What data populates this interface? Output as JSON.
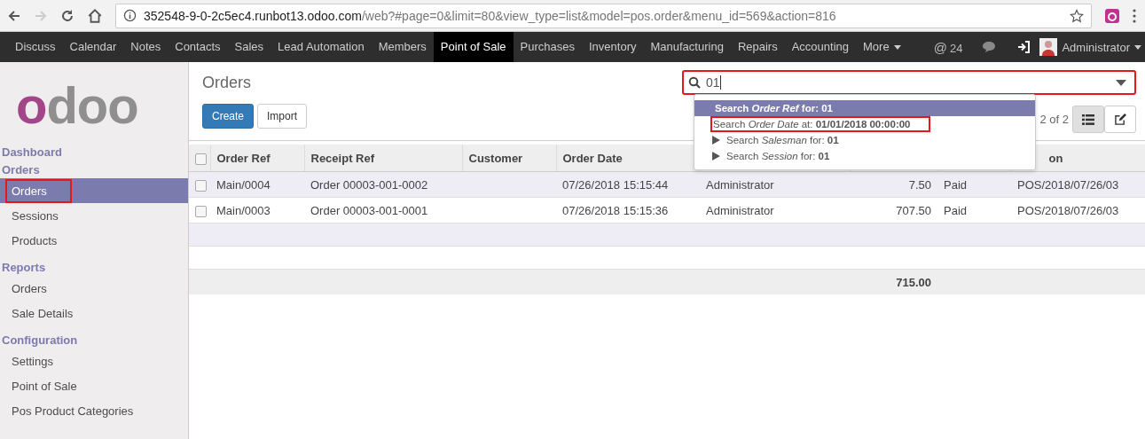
{
  "browser": {
    "url_host": "352548-9-0-2c5ec4.runbot13.odoo.com",
    "url_path": "/web?#page=0&limit=80&view_type=list&model=pos.order&menu_id=569&action=816"
  },
  "navbar": {
    "apps": [
      {
        "label": "Discuss",
        "selected": false
      },
      {
        "label": "Calendar",
        "selected": false
      },
      {
        "label": "Notes",
        "selected": false
      },
      {
        "label": "Contacts",
        "selected": false
      },
      {
        "label": "Sales",
        "selected": false
      },
      {
        "label": "Lead Automation",
        "selected": false
      },
      {
        "label": "Members",
        "selected": false
      },
      {
        "label": "Point of Sale",
        "selected": true
      },
      {
        "label": "Purchases",
        "selected": false
      },
      {
        "label": "Inventory",
        "selected": false
      },
      {
        "label": "Manufacturing",
        "selected": false
      },
      {
        "label": "Repairs",
        "selected": false
      },
      {
        "label": "Accounting",
        "selected": false
      }
    ],
    "more": "More",
    "mentions_icon": "@",
    "mentions": "24",
    "user": "Administrator"
  },
  "sidebar": {
    "logo": "odoo",
    "sections": [
      {
        "title": "Dashboard",
        "kind": "link"
      },
      {
        "title": "Orders",
        "kind": "heading",
        "items": [
          {
            "label": "Orders",
            "selected": true,
            "highlighted": true
          },
          {
            "label": "Sessions",
            "selected": false,
            "highlighted": false
          },
          {
            "label": "Products",
            "selected": false,
            "highlighted": false
          }
        ]
      },
      {
        "title": "Reports",
        "kind": "heading",
        "items": [
          {
            "label": "Orders",
            "selected": false,
            "highlighted": false
          },
          {
            "label": "Sale Details",
            "selected": false,
            "highlighted": false
          }
        ]
      },
      {
        "title": "Configuration",
        "kind": "heading",
        "items": [
          {
            "label": "Settings",
            "selected": false,
            "highlighted": false
          },
          {
            "label": "Point of Sale",
            "selected": false,
            "highlighted": false
          },
          {
            "label": "Pos Product Categories",
            "selected": false,
            "highlighted": false
          }
        ]
      }
    ]
  },
  "control_panel": {
    "breadcrumb": "Orders",
    "buttons": [
      "Create",
      "Import"
    ],
    "pager": "2 of 2",
    "views": [
      {
        "kind": "list",
        "selected": true
      },
      {
        "kind": "form",
        "selected": false
      }
    ]
  },
  "search": {
    "value": "01",
    "highlighted": true,
    "suggestions": [
      {
        "text": "Search *Order Ref* for: **01**",
        "selected": true,
        "expandable": false,
        "highlighted": false
      },
      {
        "text": "Search *Order Date* at: **01/01/2018 00:00:00**",
        "selected": false,
        "expandable": false,
        "highlighted": true
      },
      {
        "text": "Search *Salesman* for: **01**",
        "selected": false,
        "expandable": true,
        "highlighted": false
      },
      {
        "text": "Search *Session* for: **01**",
        "selected": false,
        "expandable": true,
        "highlighted": false
      }
    ]
  },
  "table": {
    "all_checked": false,
    "columns": [
      {
        "label": "Order Ref"
      },
      {
        "label": "Receipt Ref"
      },
      {
        "label": "Customer"
      },
      {
        "label": "Order Date"
      },
      {},
      {},
      {},
      {
        "label": "on"
      }
    ],
    "rows": [
      {
        "checked": false,
        "cells": [
          "Main/0004",
          "Order 00003-001-0002",
          null,
          "07/26/2018 15:15:44",
          "Administrator",
          "7.50",
          "Paid",
          "POS/2018/07/26/03"
        ]
      },
      {
        "checked": false,
        "cells": [
          "Main/0003",
          "Order 00003-001-0001",
          null,
          "07/26/2018 15:15:36",
          "Administrator",
          "707.50",
          "Paid",
          "POS/2018/07/26/03"
        ]
      }
    ],
    "total": "715.00"
  }
}
